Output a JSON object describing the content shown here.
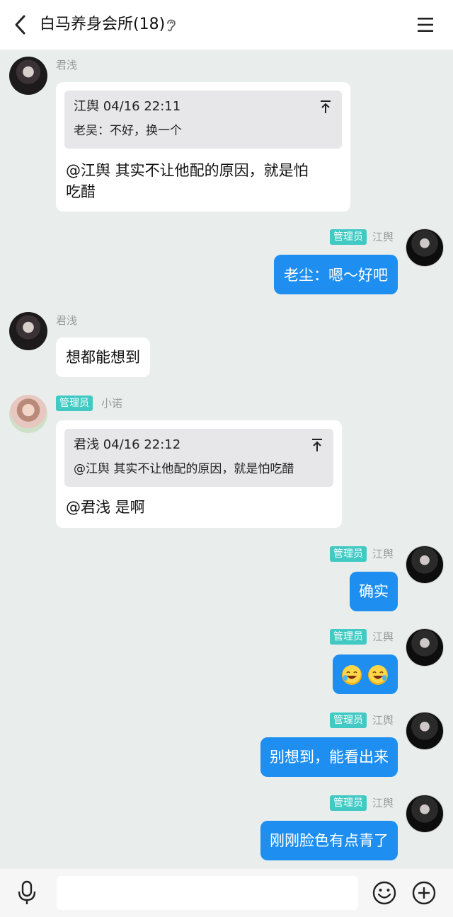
{
  "header": {
    "title": "白马养身会所(18)"
  },
  "messages": {
    "m1": {
      "sender": "君浅",
      "quote_head": "江舆 04/16 22:11",
      "quote_body": "老吴：不好，换一个",
      "text_line1": "@江舆 其实不让他配的原因，就是怕",
      "text_line2": "吃醋"
    },
    "m2": {
      "badge": "管理员",
      "sender": "江舆",
      "text": "老尘：嗯～好吧"
    },
    "m3": {
      "sender": "君浅",
      "text": "想都能想到"
    },
    "m4": {
      "badge": "管理员",
      "sender": "小诺",
      "quote_head": "君浅 04/16 22:12",
      "quote_body": "@江舆 其实不让他配的原因，就是怕吃醋",
      "text": "@君浅 是啊"
    },
    "m5": {
      "badge": "管理员",
      "sender": "江舆",
      "text": "确实"
    },
    "m6": {
      "badge": "管理员",
      "sender": "江舆",
      "emoji": "laughing-emoji x2"
    },
    "m7": {
      "badge": "管理员",
      "sender": "江舆",
      "text": "别想到，能看出来"
    },
    "m8": {
      "badge": "管理员",
      "sender": "江舆",
      "text": "刚刚脸色有点青了"
    }
  },
  "input": {
    "value": ""
  },
  "colors": {
    "background": "#e9eeec",
    "outgoing_bubble": "#1e8ff0",
    "admin_badge": "#41c9c4"
  }
}
